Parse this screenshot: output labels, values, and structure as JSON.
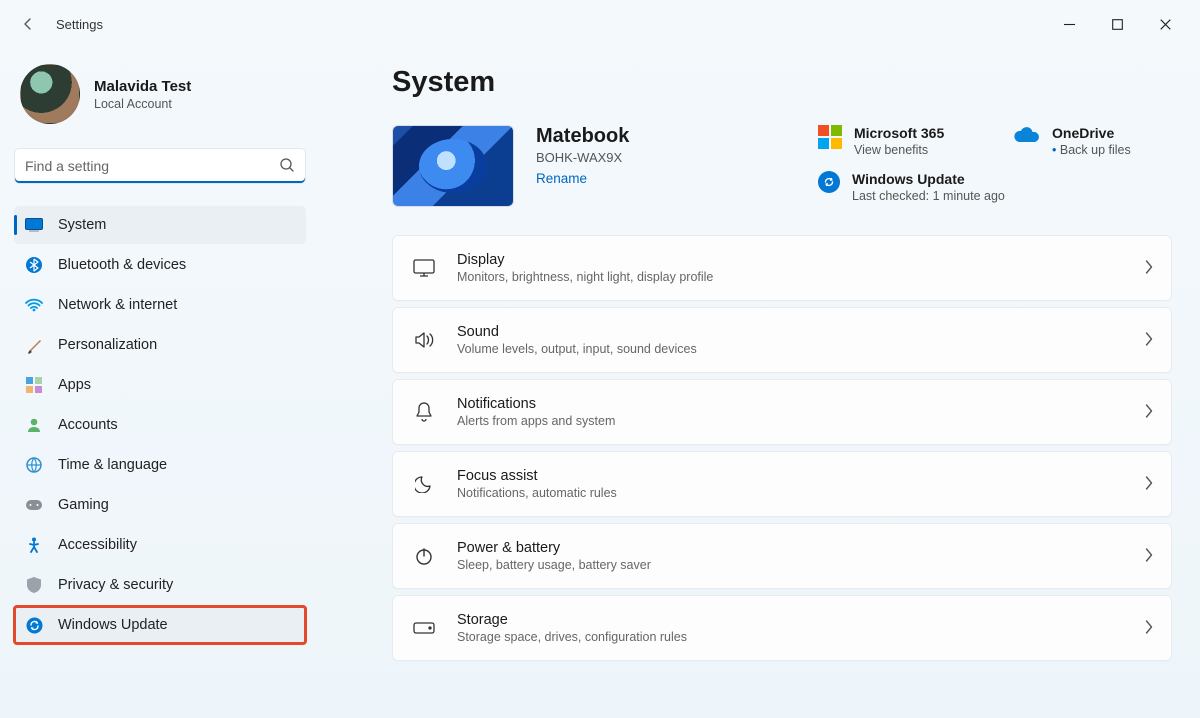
{
  "window": {
    "title": "Settings"
  },
  "profile": {
    "name": "Malavida Test",
    "account_type": "Local Account"
  },
  "search": {
    "placeholder": "Find a setting"
  },
  "sidebar": {
    "items": [
      {
        "label": "System"
      },
      {
        "label": "Bluetooth & devices"
      },
      {
        "label": "Network & internet"
      },
      {
        "label": "Personalization"
      },
      {
        "label": "Apps"
      },
      {
        "label": "Accounts"
      },
      {
        "label": "Time & language"
      },
      {
        "label": "Gaming"
      },
      {
        "label": "Accessibility"
      },
      {
        "label": "Privacy & security"
      },
      {
        "label": "Windows Update"
      }
    ]
  },
  "page": {
    "title": "System"
  },
  "device": {
    "name": "Matebook",
    "model": "BOHK-WAX9X",
    "rename": "Rename"
  },
  "info_cards": {
    "m365": {
      "title": "Microsoft 365",
      "sub": "View benefits"
    },
    "onedrive": {
      "title": "OneDrive",
      "sub": "Back up files"
    },
    "wu": {
      "title": "Windows Update",
      "sub": "Last checked: 1 minute ago"
    }
  },
  "settings": [
    {
      "title": "Display",
      "sub": "Monitors, brightness, night light, display profile"
    },
    {
      "title": "Sound",
      "sub": "Volume levels, output, input, sound devices"
    },
    {
      "title": "Notifications",
      "sub": "Alerts from apps and system"
    },
    {
      "title": "Focus assist",
      "sub": "Notifications, automatic rules"
    },
    {
      "title": "Power & battery",
      "sub": "Sleep, battery usage, battery saver"
    },
    {
      "title": "Storage",
      "sub": "Storage space, drives, configuration rules"
    }
  ]
}
